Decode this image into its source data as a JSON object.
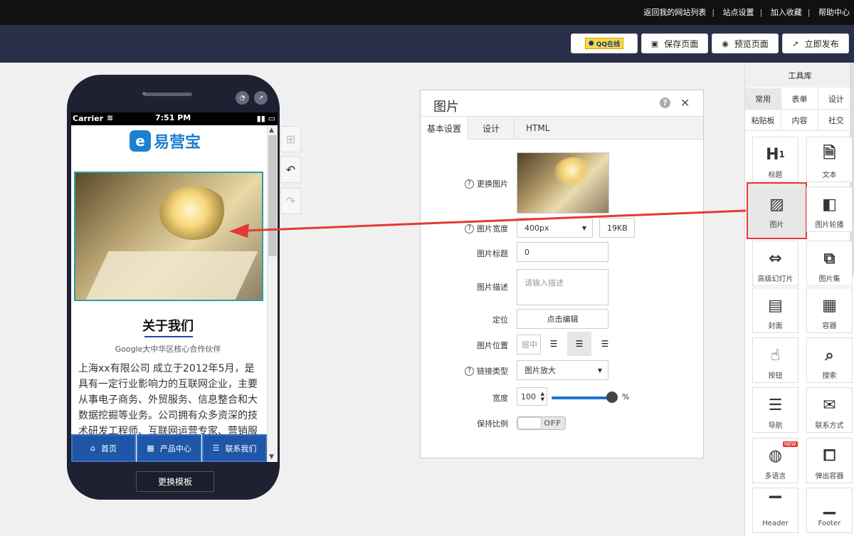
{
  "top_links": [
    "返回我的网站列表",
    "站点设置",
    "加入收藏",
    "帮助中心"
  ],
  "toolbar": {
    "qq_label": "QQ在线",
    "save_label": "保存页面",
    "preview_label": "预览页面",
    "publish_label": "立即发布"
  },
  "phone": {
    "carrier": "Carrier",
    "time": "7:51 PM",
    "logo_text": "易营宝",
    "about_title": "关于我们",
    "about_subtitle": "Google大中华区核心合作伙伴",
    "about_text": "上海xx有限公司 成立于2012年5月，是具有一定行业影响力的互联网企业，主要从事电子商务、外贸服务、信息整合和大数据挖掘等业务。公司拥有众多资深的技术研发工程师、互联网运营专家、营销服务",
    "nav": [
      "首页",
      "产品中心",
      "联系我们"
    ],
    "change_template": "更换模板"
  },
  "panel": {
    "title": "图片",
    "tabs": [
      "基本设置",
      "设计",
      "HTML"
    ],
    "fields": {
      "replace_image": "更换图片",
      "image_width": "图片宽度",
      "width_value": "400px",
      "size_value": "19KB",
      "image_title": "图片标题",
      "title_value": "0",
      "image_desc": "图片描述",
      "desc_placeholder": "请输入描述",
      "position": "定位",
      "position_button": "点击编辑",
      "image_position": "图片位置",
      "position_value": "居中",
      "link_type": "链接类型",
      "link_value": "图片放大",
      "width": "宽度",
      "width_num": "100",
      "percent": "%",
      "keep_ratio": "保持比例",
      "toggle": "OFF"
    },
    "slider_value": 1.0
  },
  "toolbox": {
    "title": "工具库",
    "tabs_row1": [
      "常用",
      "表单",
      "设计"
    ],
    "tabs_row2": [
      "粘贴板",
      "内容",
      "社交"
    ],
    "tiles": [
      {
        "label": "标题",
        "icon": "heading-icon"
      },
      {
        "label": "文本",
        "icon": "text-file-icon"
      },
      {
        "label": "图片",
        "icon": "image-icon"
      },
      {
        "label": "图片轮播",
        "icon": "carousel-icon"
      },
      {
        "label": "高级幻灯片",
        "icon": "slideshow-icon"
      },
      {
        "label": "图片集",
        "icon": "gallery-icon"
      },
      {
        "label": "封面",
        "icon": "cover-icon"
      },
      {
        "label": "容器",
        "icon": "container-icon"
      },
      {
        "label": "按钮",
        "icon": "button-tap-icon"
      },
      {
        "label": "搜索",
        "icon": "search-icon"
      },
      {
        "label": "导航",
        "icon": "nav-list-icon"
      },
      {
        "label": "联系方式",
        "icon": "contact-icon"
      },
      {
        "label": "多语言",
        "icon": "globe-icon"
      },
      {
        "label": "弹出容器",
        "icon": "popup-icon"
      },
      {
        "label": "Header",
        "icon": "header-layout-icon"
      },
      {
        "label": "Footer",
        "icon": "footer-layout-icon"
      }
    ],
    "new_badge": "NEW"
  },
  "colors": {
    "accent_red": "#e53935",
    "nav_blue": "#1f56a7",
    "toolbar_bg": "#2a2f48"
  }
}
